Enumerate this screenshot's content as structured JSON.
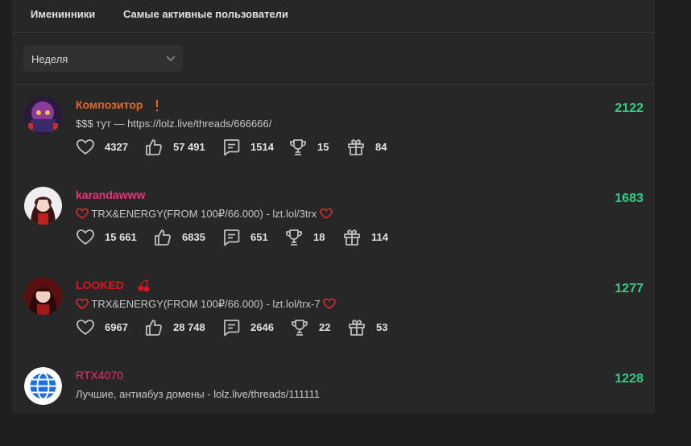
{
  "tabs": [
    {
      "label": "Именинники"
    },
    {
      "label": "Самые активные пользователи"
    }
  ],
  "filter": {
    "selected": "Неделя"
  },
  "users": [
    {
      "name": "Композитор",
      "name_color": "#e8661e",
      "status": "$$$ тут — https://lolz.live/threads/666666/",
      "score": "2122",
      "stats": {
        "likes": "4327",
        "sympathies": "57 491",
        "messages": "1514",
        "trophies": "15",
        "gifts": "84"
      }
    },
    {
      "name": "karandawww",
      "name_color": "#ee2f7b",
      "status": "TRX&ENERGY(FROM 100₽/66.000) - lzt.lol/3trx",
      "score": "1683",
      "stats": {
        "likes": "15 661",
        "sympathies": "6835",
        "messages": "651",
        "trophies": "18",
        "gifts": "114"
      }
    },
    {
      "name": "LOOKED",
      "name_color": "#e0141e",
      "status": "TRX&ENERGY(FROM 100₽/66.000) - lzt.lol/trx-7",
      "score": "1277",
      "stats": {
        "likes": "6967",
        "sympathies": "28 748",
        "messages": "2646",
        "trophies": "22",
        "gifts": "53"
      }
    },
    {
      "name": "RTX4070",
      "name_color": "#ee2f7b",
      "status": "Лучшие, антиабуз домены - lolz.live/threads/111111",
      "score": "1228"
    }
  ],
  "colors": {
    "accent": "#2fcf86",
    "background": "#272727"
  },
  "icons": [
    "heart-icon",
    "thumbs-up-icon",
    "message-icon",
    "trophy-icon",
    "gift-icon"
  ]
}
